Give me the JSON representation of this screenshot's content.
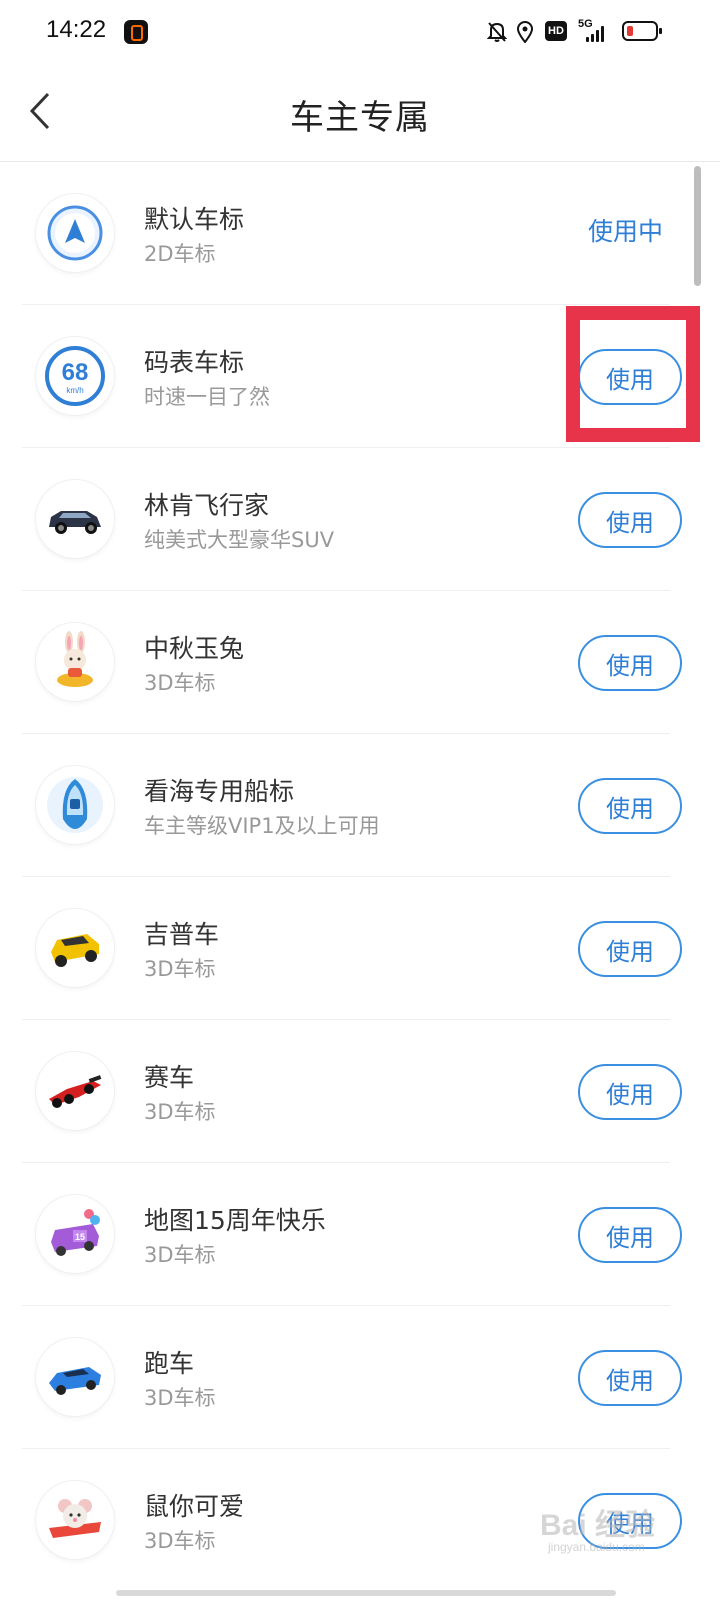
{
  "status_bar": {
    "time": "14:22",
    "hd": "HD",
    "network": "5G"
  },
  "header": {
    "title": "车主专属"
  },
  "items": [
    {
      "title": "默认车标",
      "subtitle": "2D车标",
      "action": "使用中",
      "icon": "navigation-arrow-icon"
    },
    {
      "title": "码表车标",
      "subtitle": "时速一目了然",
      "action": "使用",
      "icon": "speedometer-icon",
      "speed": "68",
      "unit": "km/h"
    },
    {
      "title": "林肯飞行家",
      "subtitle": "纯美式大型豪华SUV",
      "action": "使用",
      "icon": "suv-icon"
    },
    {
      "title": "中秋玉兔",
      "subtitle": "3D车标",
      "action": "使用",
      "icon": "rabbit-icon"
    },
    {
      "title": "看海专用船标",
      "subtitle": "车主等级VIP1及以上可用",
      "action": "使用",
      "icon": "boat-icon"
    },
    {
      "title": "吉普车",
      "subtitle": "3D车标",
      "action": "使用",
      "icon": "jeep-icon"
    },
    {
      "title": "赛车",
      "subtitle": "3D车标",
      "action": "使用",
      "icon": "race-car-icon"
    },
    {
      "title": "地图15周年快乐",
      "subtitle": "3D车标",
      "action": "使用",
      "icon": "anniversary-van-icon",
      "badge": "15"
    },
    {
      "title": "跑车",
      "subtitle": "3D车标",
      "action": "使用",
      "icon": "sports-car-icon"
    },
    {
      "title": "鼠你可爱",
      "subtitle": "3D车标",
      "action": "使用",
      "icon": "mouse-plane-icon"
    }
  ],
  "colors": {
    "accent": "#2f7fd6",
    "highlight": "#e8344a"
  },
  "watermark": {
    "text": "Bai 经验",
    "sub": "jingyan.baidu.com"
  }
}
